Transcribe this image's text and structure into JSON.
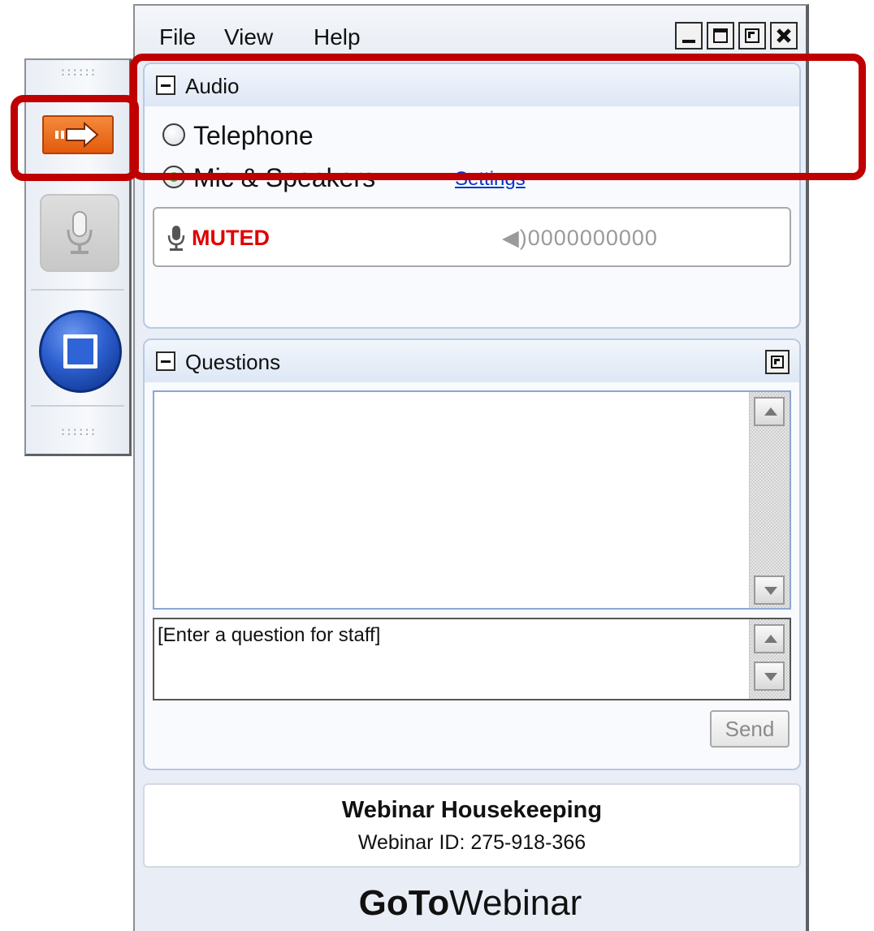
{
  "menu": {
    "file": "File",
    "view": "View",
    "help": "Help"
  },
  "window_controls": [
    "minimize-icon",
    "maximize-icon",
    "restore-icon",
    "close-icon"
  ],
  "grab_tab": {
    "buttons": [
      "show-hide-panel-icon",
      "microphone-icon",
      "screen-share-icon"
    ]
  },
  "audio": {
    "title": "Audio",
    "options": [
      {
        "label": "Telephone",
        "selected": false
      },
      {
        "label": "Mic & Speakers",
        "selected": true
      }
    ],
    "settings_link": "Settings",
    "status": "MUTED",
    "level_meter": "◀)0000000000"
  },
  "questions": {
    "title": "Questions",
    "input_text": "[Enter a question for staff]",
    "send_label": "Send"
  },
  "info": {
    "title": "Webinar Housekeeping",
    "webinar_id": "Webinar ID: 275-918-366"
  },
  "brand": {
    "part1": "GoTo",
    "part2": "Webinar"
  },
  "colors": {
    "highlight": "#c00000",
    "muted": "#e00000",
    "arrow_button": "#f07a26",
    "screen_button": "#2d5fcf",
    "link": "#0033cc"
  }
}
